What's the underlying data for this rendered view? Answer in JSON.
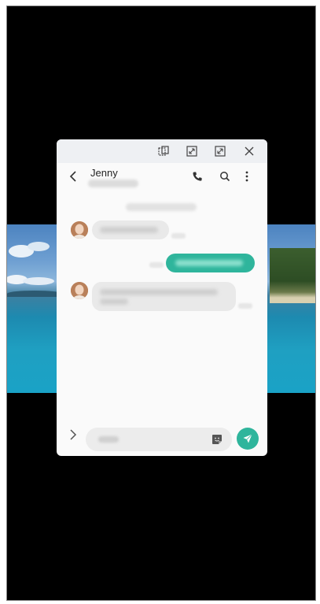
{
  "conversation": {
    "contact_name": "Jenny"
  },
  "window_controls": [
    "switch-window-icon",
    "minimize-icon",
    "maximize-icon",
    "close-icon"
  ],
  "header_actions": [
    "phone-icon",
    "search-icon",
    "more-icon"
  ],
  "colors": {
    "accent": "#2fb59c",
    "incoming_bubble": "#e9e9e9",
    "window_bar": "#eef0f3",
    "screen_bg": "#000000"
  }
}
